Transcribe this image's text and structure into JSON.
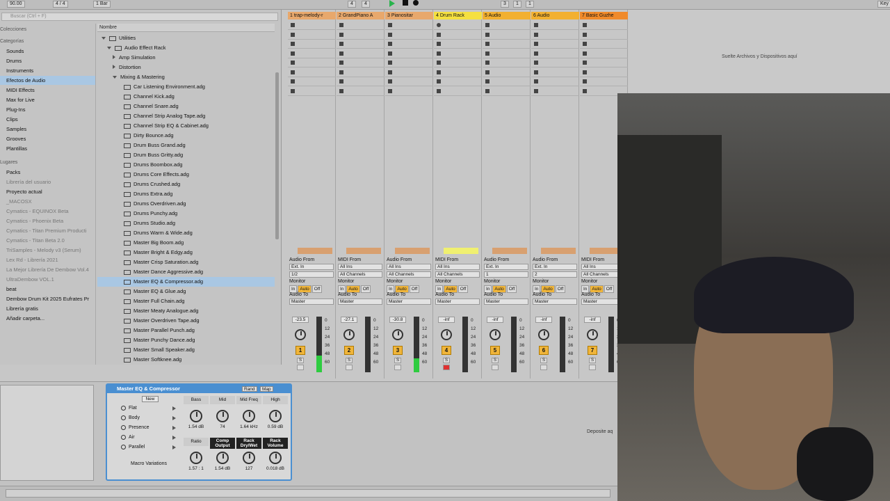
{
  "transport": {
    "tempo": "90.00",
    "signature": "4 / 4",
    "quant": "1 Bar",
    "pos1": "4",
    "pos2": "4",
    "loop1": "3",
    "loop2": "1",
    "loop3": "1",
    "key": "Key"
  },
  "browser": {
    "search_placeholder": "Buscar (Ctrl + F)",
    "colecciones": "Colecciones",
    "categorias": "Categorías",
    "categories": [
      "Sounds",
      "Drums",
      "Instruments",
      "Efectos de Audio",
      "MIDI Effects",
      "Max for Live",
      "Plug-Ins",
      "Clips",
      "Samples",
      "Grooves",
      "Plantillas"
    ],
    "lugares": "Lugares",
    "places": [
      "Packs",
      "Librería del usuario",
      "Proyecto actual",
      "_MACOSX",
      "Cymatics - EQUINOX Beta",
      "Cymatics - Phoenix Beta",
      "Cymatics - Titan Premium Producti",
      "Cymatics - Titan Beta 2.0",
      "TriSamples - Melody v3 (Serum)",
      "Lex Rd - Librería 2021",
      "La Mejor Librería De Dembow Vol.4",
      "UltraDembow VOL.1",
      "beat",
      "Dembow Drum Kit 2025 Eufrates Pr",
      "Librería gratis",
      "Añadir carpeta..."
    ],
    "name_header": "Nombre",
    "tree": [
      "Utilities",
      "Audio Effect Rack",
      "Amp Simulation",
      "Distortion",
      "Mixing & Mastering"
    ],
    "files": [
      "Car Listening Environment.adg",
      "Channel Kick.adg",
      "Channel Snare.adg",
      "Channel Strip Analog Tape.adg",
      "Channel Strip EQ & Cabinet.adg",
      "Dirty Bounce.adg",
      "Drum Buss Grand.adg",
      "Drum Buss Gritty.adg",
      "Drums Boombox.adg",
      "Drums Core Effects.adg",
      "Drums Crushed.adg",
      "Drums Extra.adg",
      "Drums Overdriven.adg",
      "Drums Punchy.adg",
      "Drums Studio.adg",
      "Drums Warm & Wide.adg",
      "Master Big Boom.adg",
      "Master Bright & Edgy.adg",
      "Master Crisp Saturation.adg",
      "Master Dance Aggressive.adg",
      "Master EQ & Compressor.adg",
      "Master EQ & Glue.adg",
      "Master Full Chain.adg",
      "Master Meaty Analogue.adg",
      "Master Overdriven Tape.adg",
      "Master Parallel Punch.adg",
      "Master Punchy Dance.adg",
      "Master Small Speaker.adg",
      "Master Softknee.adg"
    ]
  },
  "tracks": [
    {
      "name": "1 trap-melody-r",
      "color": "#e8a86c",
      "io_label": "Audio From",
      "in1": "Ext. In",
      "in2": "1/2",
      "vol": "-23.5",
      "num": "1",
      "meter": 0.3
    },
    {
      "name": "2 GrandPiano A",
      "color": "#e8a86c",
      "io_label": "MIDI From",
      "in1": "All Ins",
      "in2": "All Channels",
      "vol": "-27.1",
      "num": "2",
      "meter": 0
    },
    {
      "name": "3 Pianositar",
      "color": "#e8a86c",
      "io_label": "Audio From",
      "in1": "All Ins",
      "in2": "All Channels",
      "vol": "-30.8",
      "num": "3",
      "meter": 0.25
    },
    {
      "name": "4 Drum Rack",
      "color": "#f5e040",
      "io_label": "MIDI From",
      "in1": "All Ins",
      "in2": "All Channels",
      "vol": "-inf",
      "num": "4",
      "meter": 0
    },
    {
      "name": "5 Audio",
      "color": "#f2b030",
      "io_label": "Audio From",
      "in1": "Ext. In",
      "in2": "1",
      "vol": "-inf",
      "num": "5",
      "meter": 0
    },
    {
      "name": "6 Audio",
      "color": "#f2b030",
      "io_label": "Audio From",
      "in1": "Ext. In",
      "in2": "2",
      "vol": "-inf",
      "num": "6",
      "meter": 0
    },
    {
      "name": "7 Basic Guzhe",
      "color": "#f08a2a",
      "io_label": "MIDI From",
      "in1": "All Ins",
      "in2": "All Channels",
      "vol": "-inf",
      "num": "7",
      "meter": 0
    }
  ],
  "mixer": {
    "monitor": "Monitor",
    "in": "In",
    "auto": "Auto",
    "off": "Off",
    "audio_to": "Audio To",
    "master": "Master",
    "solo": "S",
    "scale": [
      "0",
      "12",
      "24",
      "36",
      "48",
      "60"
    ]
  },
  "dropzone": "Suelte Archivos y Dispositivos aquí",
  "deposit": "Deposite aq",
  "rack": {
    "title": "Master EQ & Compressor",
    "rand": "Rand",
    "map": "Map",
    "new": "New",
    "chains": [
      "Flat",
      "Body",
      "Presence",
      "Air",
      "Parallel"
    ],
    "variations": "Macro Variations",
    "macros": [
      {
        "label": "Bass",
        "value": "1.54 dB"
      },
      {
        "label": "Mid",
        "value": "74"
      },
      {
        "label": "Mid Freq",
        "value": "1.64 kHz"
      },
      {
        "label": "High",
        "value": "0.59 dB"
      },
      {
        "label": "Ratio",
        "value": "1.57 : 1"
      },
      {
        "label": "Comp Output",
        "value": "1.54 dB"
      },
      {
        "label": "Rack Dry/Wet",
        "value": "127"
      },
      {
        "label": "Rack Volume",
        "value": "0.018 dB"
      }
    ]
  }
}
